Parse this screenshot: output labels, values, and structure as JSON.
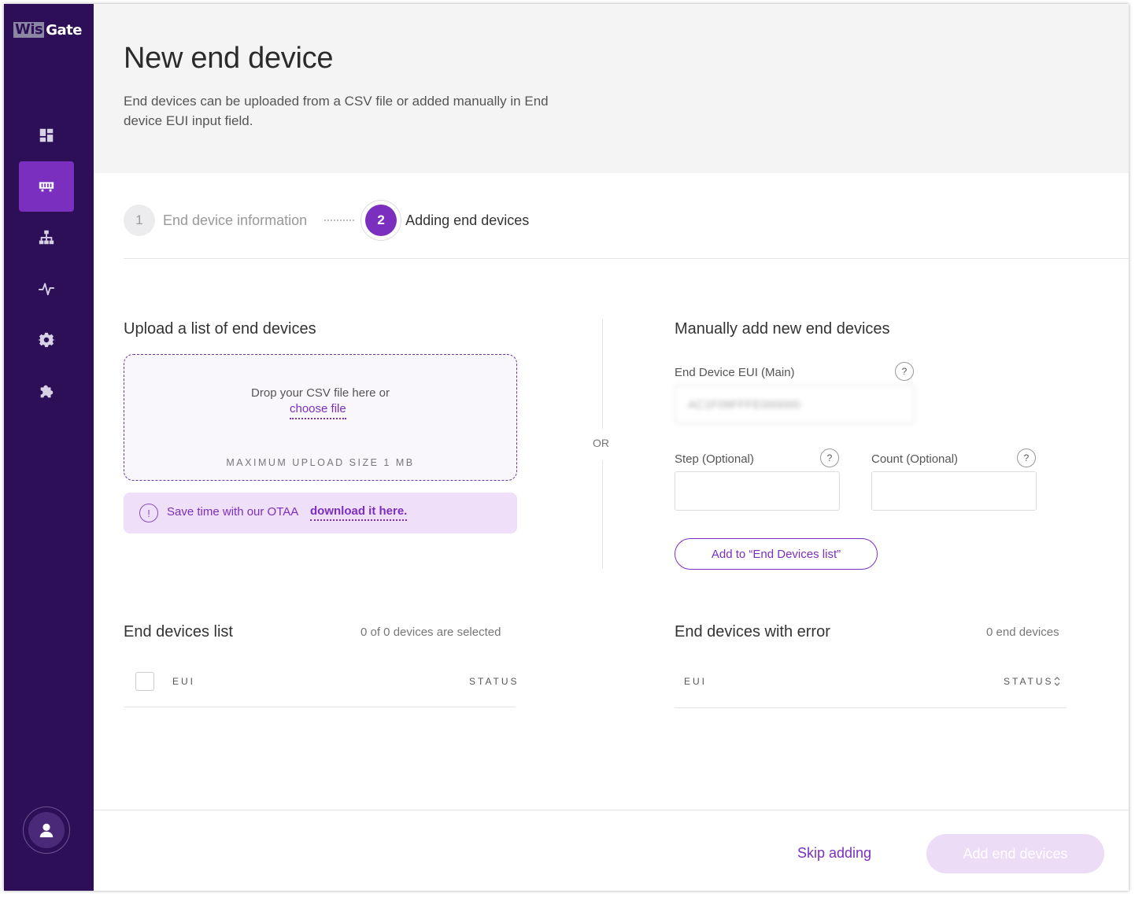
{
  "app": {
    "logo_part1": "Wis",
    "logo_part2": "Gate"
  },
  "sidebar": {
    "items": [
      {
        "name": "dashboard",
        "icon": "dashboard-icon"
      },
      {
        "name": "devices",
        "icon": "device-icon",
        "active": true
      },
      {
        "name": "network",
        "icon": "network-icon"
      },
      {
        "name": "activity",
        "icon": "pulse-icon"
      },
      {
        "name": "settings",
        "icon": "gear-icon"
      },
      {
        "name": "extensions",
        "icon": "puzzle-icon"
      }
    ],
    "user_icon": "user-icon"
  },
  "header": {
    "title": "New end device",
    "description": "End devices can be uploaded from a CSV file or added manually in End device EUI input field."
  },
  "stepper": {
    "step1_number": "1",
    "step1_label": "End device information",
    "step2_number": "2",
    "step2_label": "Adding end devices"
  },
  "upload": {
    "title": "Upload a list of end devices",
    "drop_text": "Drop your CSV file here or",
    "choose_file": "choose file",
    "max_size": "MAXIMUM UPLOAD SIZE 1 MB",
    "otaa_icon": "!",
    "otaa_text": "Save time with our OTAA",
    "otaa_link": "download it here."
  },
  "divider": {
    "or": "OR"
  },
  "manual": {
    "title": "Manually add new end devices",
    "eui_label": "End Device EUI (Main)",
    "eui_value": "AC1F09FFFE000000",
    "step_label": "Step (Optional)",
    "step_value": "",
    "count_label": "Count (Optional)",
    "count_value": "",
    "help": "?",
    "add_button": "Add to “End Devices list”"
  },
  "end_devices_list": {
    "title": "End devices list",
    "count": "0 of 0 devices are selected",
    "col_eui": "EUI",
    "col_status": "STATUS"
  },
  "error_list": {
    "title": "End devices with error",
    "count": "0 end devices",
    "col_eui": "EUI",
    "col_status": "STATUS"
  },
  "footer": {
    "skip": "Skip adding",
    "add": "Add end devices"
  },
  "colors": {
    "sidebar": "#2d0f57",
    "accent": "#7b2fbf",
    "accent_light": "#efdff8"
  }
}
